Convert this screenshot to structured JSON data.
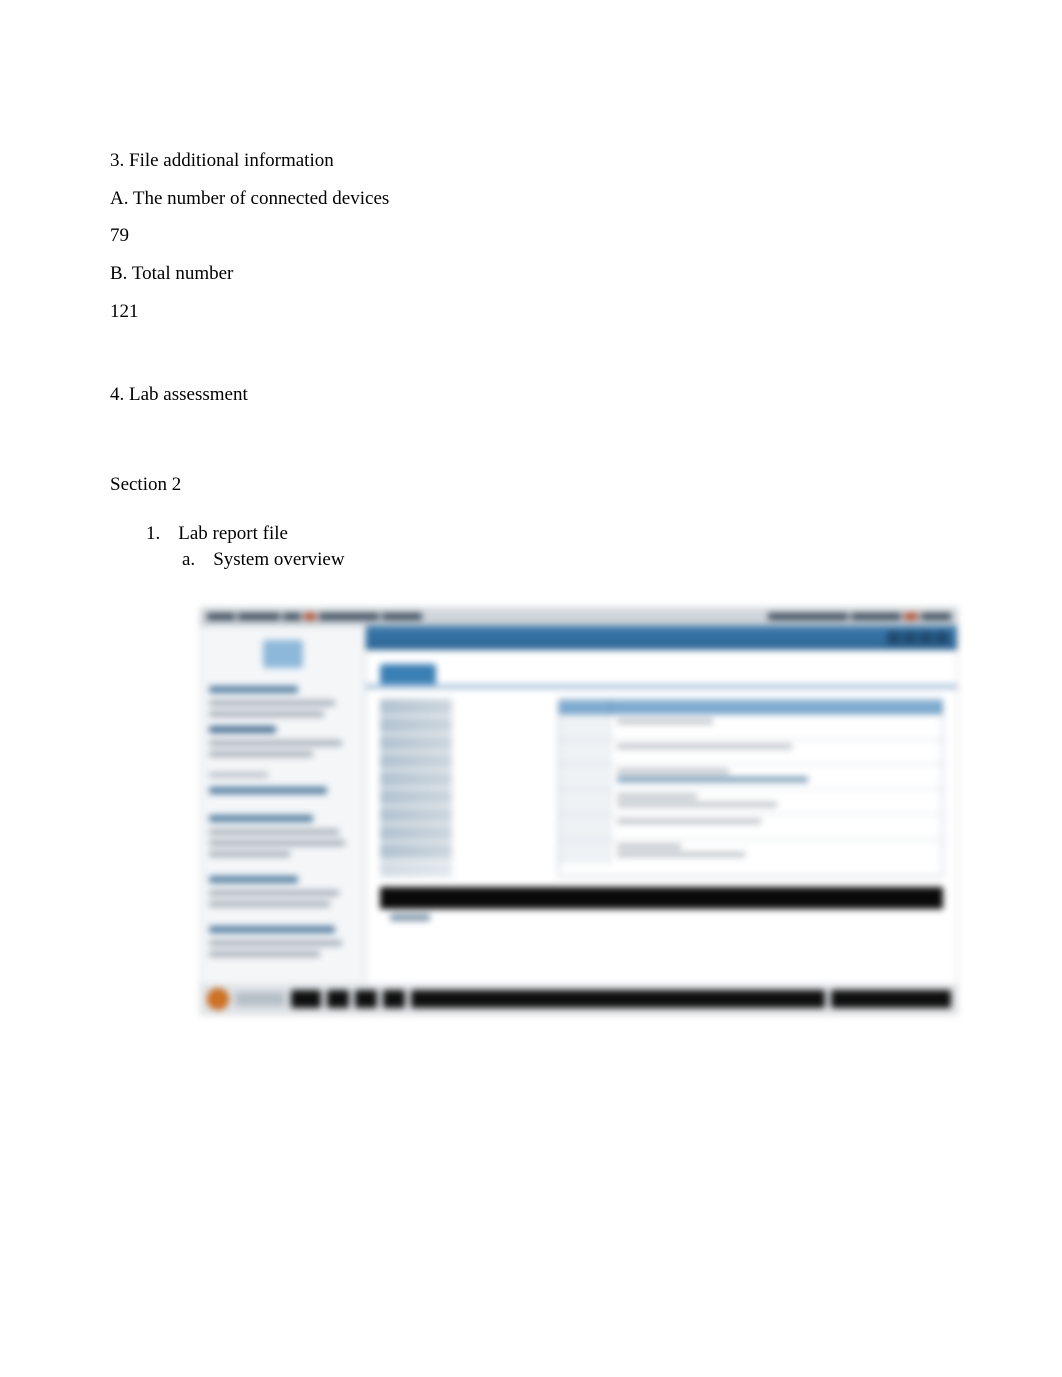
{
  "doc": {
    "heading3": "3. File additional information",
    "subA": "A. The number of connected devices",
    "valA": "79",
    "subB": "B. Total number",
    "valB": "121",
    "heading4": "4. Lab assessment",
    "section2": "Section 2",
    "list1_marker": "1.",
    "list1_text": "Lab report file",
    "list1a_marker": "a.",
    "list1a_text": "System overview"
  }
}
